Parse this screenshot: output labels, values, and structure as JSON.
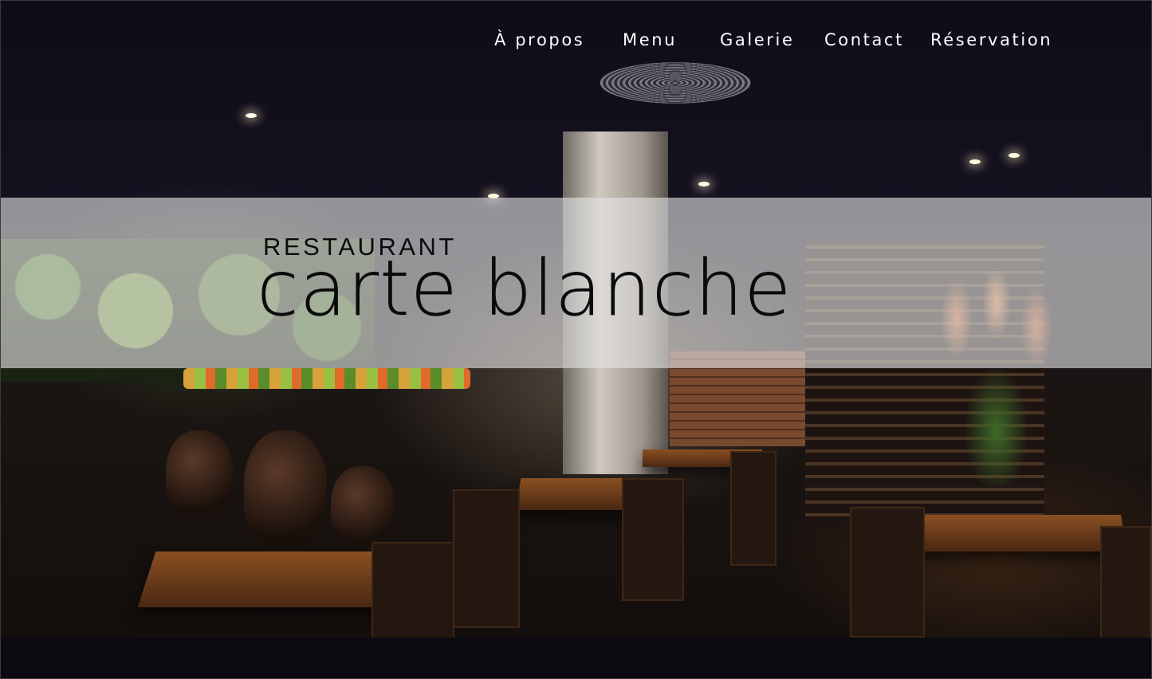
{
  "nav": {
    "items": [
      {
        "label": "À propos"
      },
      {
        "label": "Menu"
      },
      {
        "label": "Galerie"
      },
      {
        "label": "Contact"
      },
      {
        "label": "Réservation"
      }
    ]
  },
  "hero": {
    "overline": "RESTAURANT",
    "title": "carte blanche"
  },
  "colors": {
    "nav_text": "#ffffff",
    "band_overlay": "#e4e4e4",
    "hero_text": "#0a0a0a"
  }
}
